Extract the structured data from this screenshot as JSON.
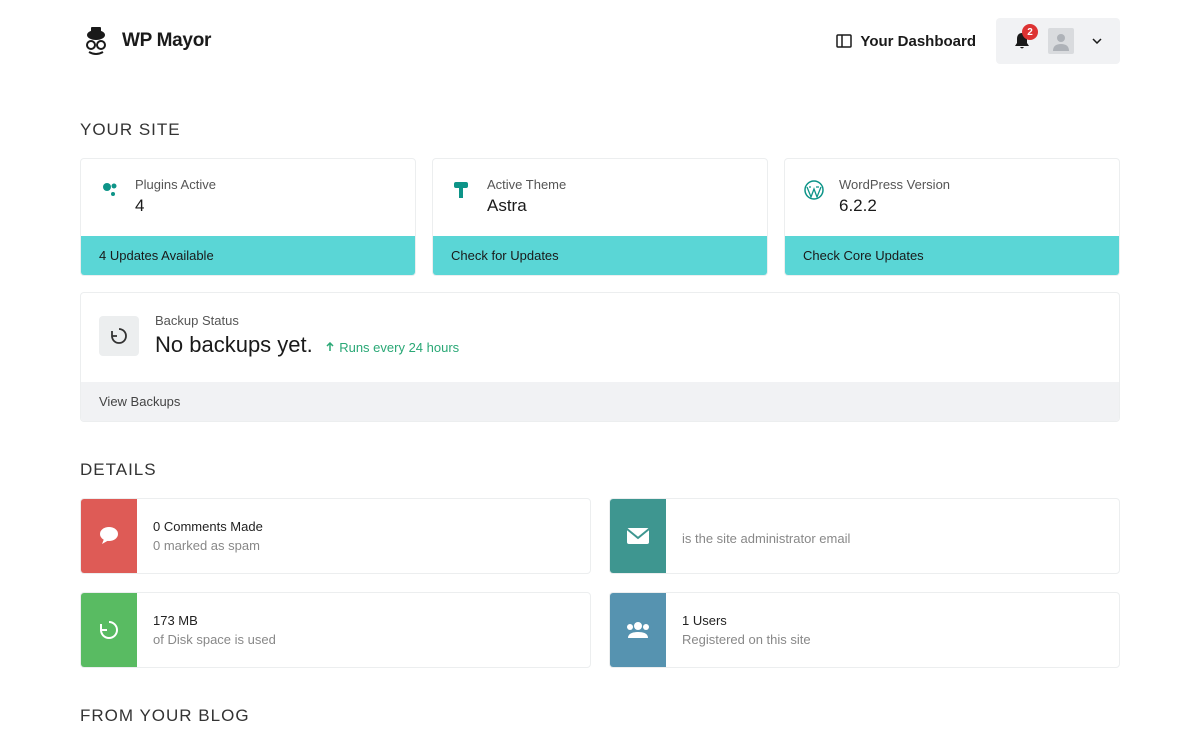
{
  "header": {
    "brand": "WP Mayor",
    "dashboard_link": "Your Dashboard",
    "notification_count": "2"
  },
  "sections": {
    "your_site": "YOUR SITE",
    "details": "DETAILS",
    "from_blog": "FROM YOUR BLOG"
  },
  "site_cards": {
    "plugins": {
      "label": "Plugins Active",
      "value": "4",
      "footer": "4 Updates Available"
    },
    "theme": {
      "label": "Active Theme",
      "value": "Astra",
      "footer": "Check for Updates"
    },
    "wp": {
      "label": "WordPress Version",
      "value": "6.2.2",
      "footer": "Check Core Updates"
    }
  },
  "backup": {
    "label": "Backup Status",
    "value": "No backups yet.",
    "hint": "Runs every 24 hours",
    "footer": "View Backups"
  },
  "details": {
    "comments": {
      "line1": "0 Comments Made",
      "line2": "0 marked as spam"
    },
    "email": {
      "line1": "",
      "line2": "is the site administrator email"
    },
    "disk": {
      "line1": "173 MB",
      "line2": "of Disk space is used"
    },
    "users": {
      "line1": "1 Users",
      "line2": "Registered on this site"
    }
  }
}
